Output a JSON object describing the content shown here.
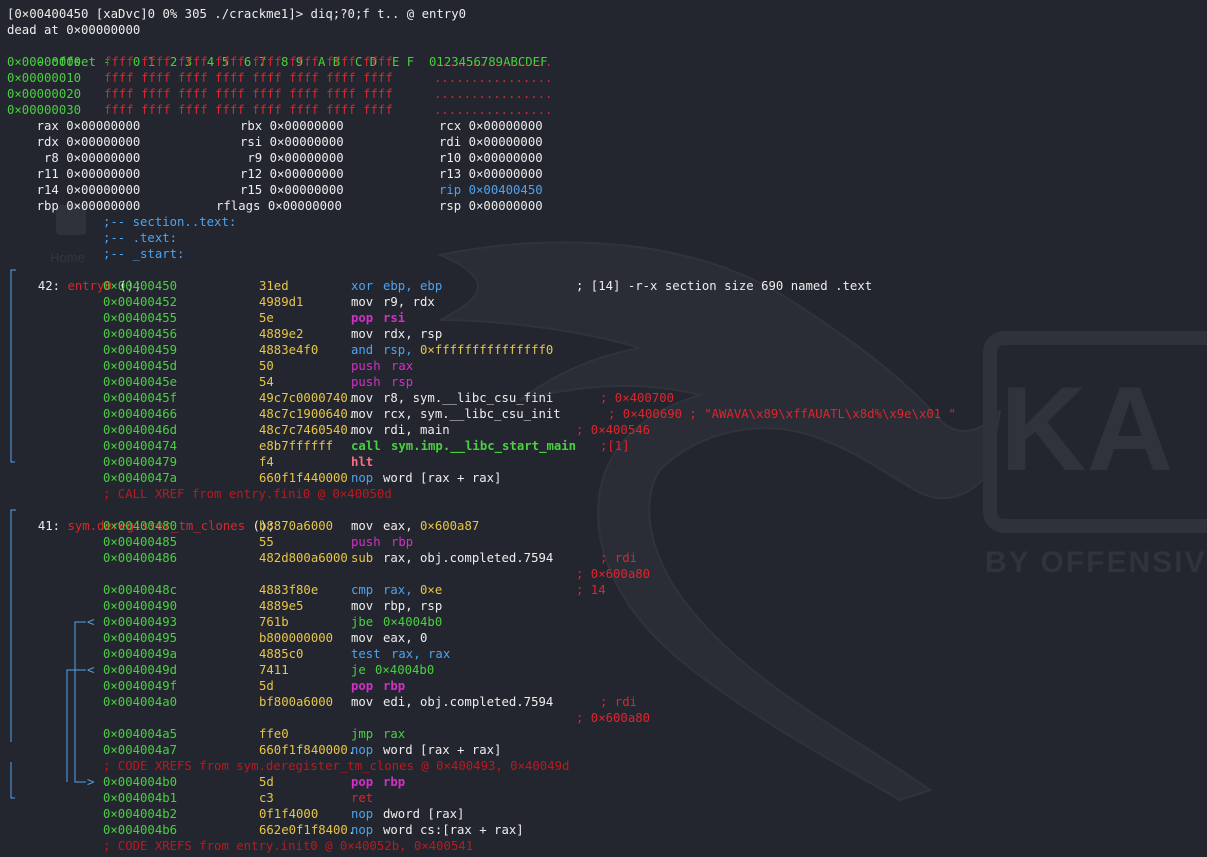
{
  "header": {
    "prompt": "[0×00400450 [xaDvc]0 0% 305 ./crackme1]> diq;?0;f t.. @ entry0",
    "dead_at": "dead at 0×00000000"
  },
  "hexdump": {
    "header_prefix": "- offset -",
    "header_cols": "   0 1  2 3  4 5  6 7  8 9  A B  C D  E F  ",
    "header_ascii": "0123456789ABCDEF",
    "rows": [
      {
        "offset": "0×00000000",
        "hex": "ffff ffff ffff ffff ffff ffff ffff ffff",
        "ascii": "................"
      },
      {
        "offset": "0×00000010",
        "hex": "ffff ffff ffff ffff ffff ffff ffff ffff",
        "ascii": "................"
      },
      {
        "offset": "0×00000020",
        "hex": "ffff ffff ffff ffff ffff ffff ffff ffff",
        "ascii": "................"
      },
      {
        "offset": "0×00000030",
        "hex": "ffff ffff ffff ffff ffff ffff ffff ffff",
        "ascii": "................"
      }
    ]
  },
  "registers": [
    [
      "    rax 0×00000000",
      "rbx 0×00000000",
      "rcx 0×00000000"
    ],
    [
      "    rdx 0×00000000",
      "rsi 0×00000000",
      "rdi 0×00000000"
    ],
    [
      "     r8 0×00000000",
      " r9 0×00000000",
      "r10 0×00000000"
    ],
    [
      "    r11 0×00000000",
      "r12 0×00000000",
      "r13 0×00000000"
    ],
    [
      "    r14 0×00000000",
      "r15 0×00000000",
      "rip 0×00400450"
    ],
    [
      "    rbp 0×00000000",
      "rflags 0×00000000",
      "rsp 0×00000000"
    ]
  ],
  "section_comments": [
    ";-- section..text:",
    ";-- .text:",
    ";-- _start:"
  ],
  "functions": {
    "f1": {
      "num": "42:",
      "name": "entry0",
      "sig": " ();"
    },
    "f2": {
      "num": "41:",
      "name": "sym.deregister_tm_clones",
      "sig": " ();"
    }
  },
  "disasm": [
    {
      "addr": "0×00400450",
      "bytes": "31ed",
      "mn": "xor",
      "ops": "ebp, ebp",
      "cmt": "; [14] -r-x section size 690 named .text"
    },
    {
      "addr": "0×00400452",
      "bytes": "4989d1",
      "mn": "mov",
      "ops": "r9, rdx"
    },
    {
      "addr": "0×00400455",
      "bytes": "5e",
      "mn": "pop",
      "ops": "rsi"
    },
    {
      "addr": "0×00400456",
      "bytes": "4889e2",
      "mn": "mov",
      "ops": "rdx, rsp"
    },
    {
      "addr": "0×00400459",
      "bytes": "4883e4f0",
      "mn": "and",
      "ops": "rsp, 0×fffffffffffffff0"
    },
    {
      "addr": "0×0040045d",
      "bytes": "50",
      "mn": "push",
      "ops": "rax"
    },
    {
      "addr": "0×0040045e",
      "bytes": "54",
      "mn": "push",
      "ops": "rsp"
    },
    {
      "addr": "0×0040045f",
      "bytes": "49c7c0000740.",
      "mn": "mov",
      "ops": "r8, sym.__libc_csu_fini",
      "cmt": "; 0×400700"
    },
    {
      "addr": "0×00400466",
      "bytes": "48c7c1900640.",
      "mn": "mov",
      "ops": "rcx, sym.__libc_csu_init",
      "cmt": "; 0×400690 ; \"AWAVA\\x89\\xffAUATL\\x8d%\\x9e\\x01 \""
    },
    {
      "addr": "0×0040046d",
      "bytes": "48c7c7460540.",
      "mn": "mov",
      "ops": "rdi, main",
      "cmt": "; 0×400546"
    },
    {
      "addr": "0×00400474",
      "bytes": "e8b7ffffff",
      "mn": "call",
      "ops": "sym.imp.__libc_start_main",
      "cmt": ";[1]"
    },
    {
      "addr": "0×00400479",
      "bytes": "f4",
      "mn": "hlt",
      "ops": ""
    },
    {
      "addr": "0×0040047a",
      "bytes": "660f1f440000",
      "mn": "nop",
      "ops": "word [rax + rax]"
    },
    {
      "addr": "0×00400480",
      "bytes": "b8870a6000",
      "mn": "mov",
      "ops": "eax, 0×600a87"
    },
    {
      "addr": "0×00400485",
      "bytes": "55",
      "mn": "push",
      "ops": "rbp"
    },
    {
      "addr": "0×00400486",
      "bytes": "482d800a6000",
      "mn": "sub",
      "ops": "rax, obj.completed.7594",
      "cmt": "; rdi",
      "cmt2": "; 0×600a80"
    },
    {
      "addr": "0×0040048c",
      "bytes": "4883f80e",
      "mn": "cmp",
      "ops": "rax, 0×e",
      "cmt": "; 14"
    },
    {
      "addr": "0×00400490",
      "bytes": "4889e5",
      "mn": "mov",
      "ops": "rbp, rsp"
    },
    {
      "addr": "0×00400493",
      "bytes": "761b",
      "mn": "jbe",
      "ops": "0×4004b0"
    },
    {
      "addr": "0×00400495",
      "bytes": "b800000000",
      "mn": "mov",
      "ops": "eax, 0"
    },
    {
      "addr": "0×0040049a",
      "bytes": "4885c0",
      "mn": "test",
      "ops": "rax, rax"
    },
    {
      "addr": "0×0040049d",
      "bytes": "7411",
      "mn": "je",
      "ops": "0×4004b0"
    },
    {
      "addr": "0×0040049f",
      "bytes": "5d",
      "mn": "pop",
      "ops": "rbp"
    },
    {
      "addr": "0×004004a0",
      "bytes": "bf800a6000",
      "mn": "mov",
      "ops": "edi, obj.completed.7594",
      "cmt": "; rdi",
      "cmt2": "; 0×600a80"
    },
    {
      "addr": "0×004004a5",
      "bytes": "ffe0",
      "mn": "jmp",
      "ops": "rax"
    },
    {
      "addr": "0×004004a7",
      "bytes": "660f1f840000.",
      "mn": "nop",
      "ops": "word [rax + rax]"
    },
    {
      "addr": "0×004004b0",
      "bytes": "5d",
      "mn": "pop",
      "ops": "rbp"
    },
    {
      "addr": "0×004004b1",
      "bytes": "c3",
      "mn": "ret",
      "ops": ""
    },
    {
      "addr": "0×004004b2",
      "bytes": "0f1f4000",
      "mn": "nop",
      "ops": "dword [rax]"
    },
    {
      "addr": "0×004004b6",
      "bytes": "662e0f1f8400.",
      "mn": "nop",
      "ops": "word cs:[rax + rax]"
    }
  ],
  "xrefs": {
    "call": "; CALL XREF from entry.fini0 @ 0×40050d",
    "code1": "; CODE XREFS from sym.deregister_tm_clones @ 0×400493, 0×40049d",
    "code2": "; CODE XREFS from entry.init0 @ 0×40052b, 0×400541"
  },
  "arrows": {
    "left": "<",
    "right": ">"
  },
  "background": {
    "logo_text": "KA",
    "tagline": "BY OFFENSIVE",
    "ghost_label": "Home"
  },
  "colors": {
    "background": "#23262e",
    "green": "#48d03f",
    "yellow": "#e8c547",
    "red": "#e0242c",
    "magenta": "#d32fc7",
    "blue": "#4ea3f0"
  }
}
